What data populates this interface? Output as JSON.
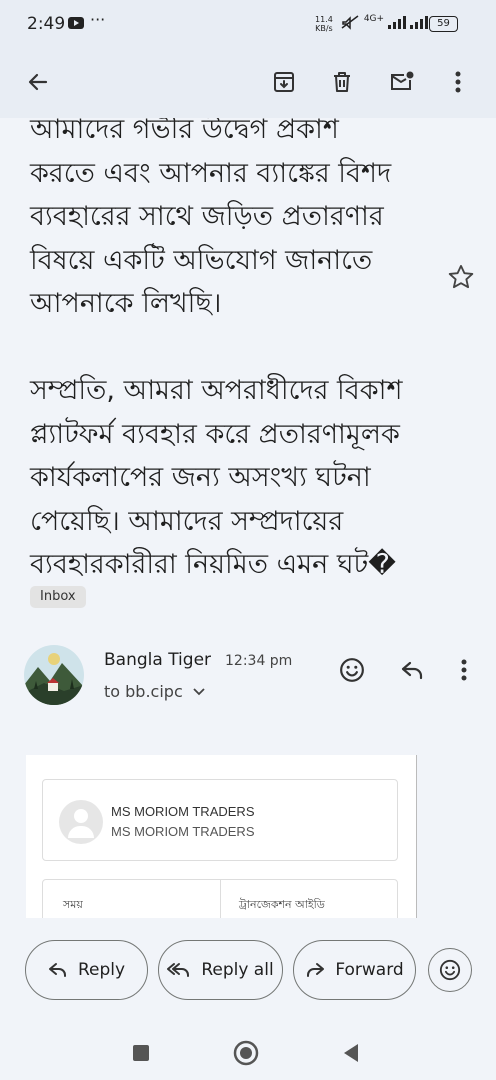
{
  "status_bar": {
    "time": "2:49",
    "dots": "···",
    "net_speed_value": "11.4",
    "net_speed_unit": "KB/s",
    "network": "4G+",
    "battery": "59"
  },
  "toolbar": {
    "icons": [
      "back-arrow-icon",
      "archive-icon",
      "delete-icon",
      "mark-unread-icon",
      "more-vert-icon"
    ]
  },
  "email": {
    "body_lines_para1": [
      "আমাদের গভীর উদ্বেগ প্রকাশ",
      "করতে এবং আপনার ব্যাঙ্কের বিশদ",
      "ব্যবহারের সাথে জড়িত প্রতারণার",
      "বিষয়ে একটি অভিযোগ জানাতে",
      "আপনাকে লিখছি।"
    ],
    "body_lines_para2": [
      "সম্প্রতি, আমরা অপরাধীদের বিকাশ",
      "প্ল্যাটফর্ম ব্যবহার করে প্রতারণামূলক",
      "কার্যকলাপের জন্য অসংখ্য ঘটনা",
      "পেয়েছি। আমাদের সম্প্রদায়ের",
      "ব্যবহারকারীরা নিয়মিত এমন ঘট�"
    ],
    "label": "Inbox"
  },
  "message": {
    "sender": "Bangla Tiger",
    "time": "12:34 pm",
    "to": "to bb.cipc",
    "merchant_name": "MS MORIOM TRADERS",
    "merchant_sub": "MS MORIOM TRADERS",
    "table_label_time": "সময়",
    "table_label_txn": "ট্রানজেকশন আইডি"
  },
  "actions": {
    "reply": "Reply",
    "reply_all": "Reply all",
    "forward": "Forward"
  },
  "colors": {
    "background": "#f1f4f9",
    "toolbar": "#e8edf4",
    "text": "#1f1f1f"
  }
}
